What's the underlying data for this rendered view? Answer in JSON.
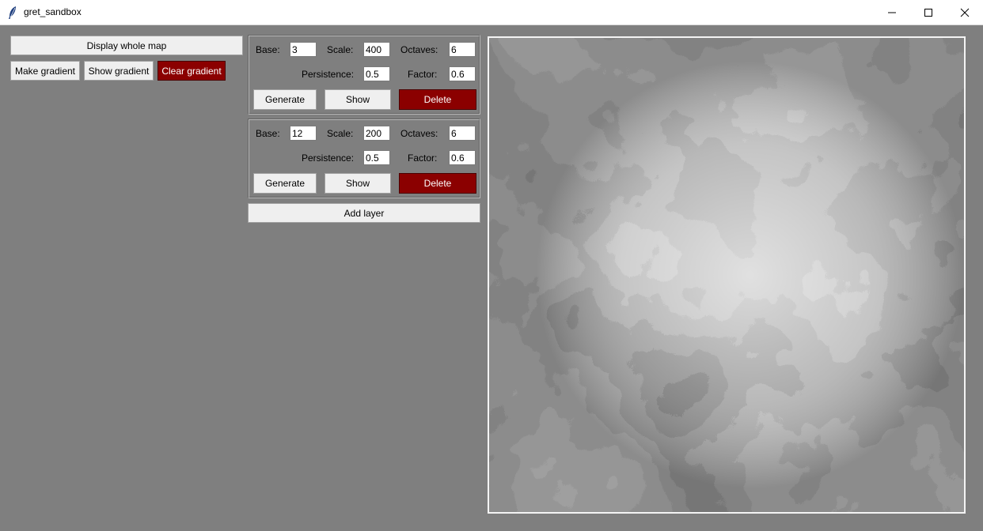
{
  "window": {
    "title": "gret_sandbox",
    "minimize_icon": "minimize-icon",
    "maximize_icon": "maximize-icon",
    "close_icon": "close-icon"
  },
  "controls": {
    "display_whole_map": "Display whole map",
    "make_gradient": "Make gradient",
    "show_gradient": "Show gradient",
    "clear_gradient": "Clear gradient",
    "add_layer": "Add layer"
  },
  "labels": {
    "base": "Base:",
    "scale": "Scale:",
    "octaves": "Octaves:",
    "persistence": "Persistence:",
    "factor": "Factor:",
    "generate": "Generate",
    "show": "Show",
    "delete": "Delete"
  },
  "layers": [
    {
      "base": "3",
      "scale": "400",
      "octaves": "6",
      "persistence": "0.5",
      "factor": "0.6"
    },
    {
      "base": "12",
      "scale": "200",
      "octaves": "6",
      "persistence": "0.5",
      "factor": "0.6"
    }
  ],
  "colors": {
    "background": "#7f7f7f",
    "button": "#efefef",
    "danger_button": "#8b0000"
  },
  "map": {
    "description": "grayscale terrain height map"
  }
}
